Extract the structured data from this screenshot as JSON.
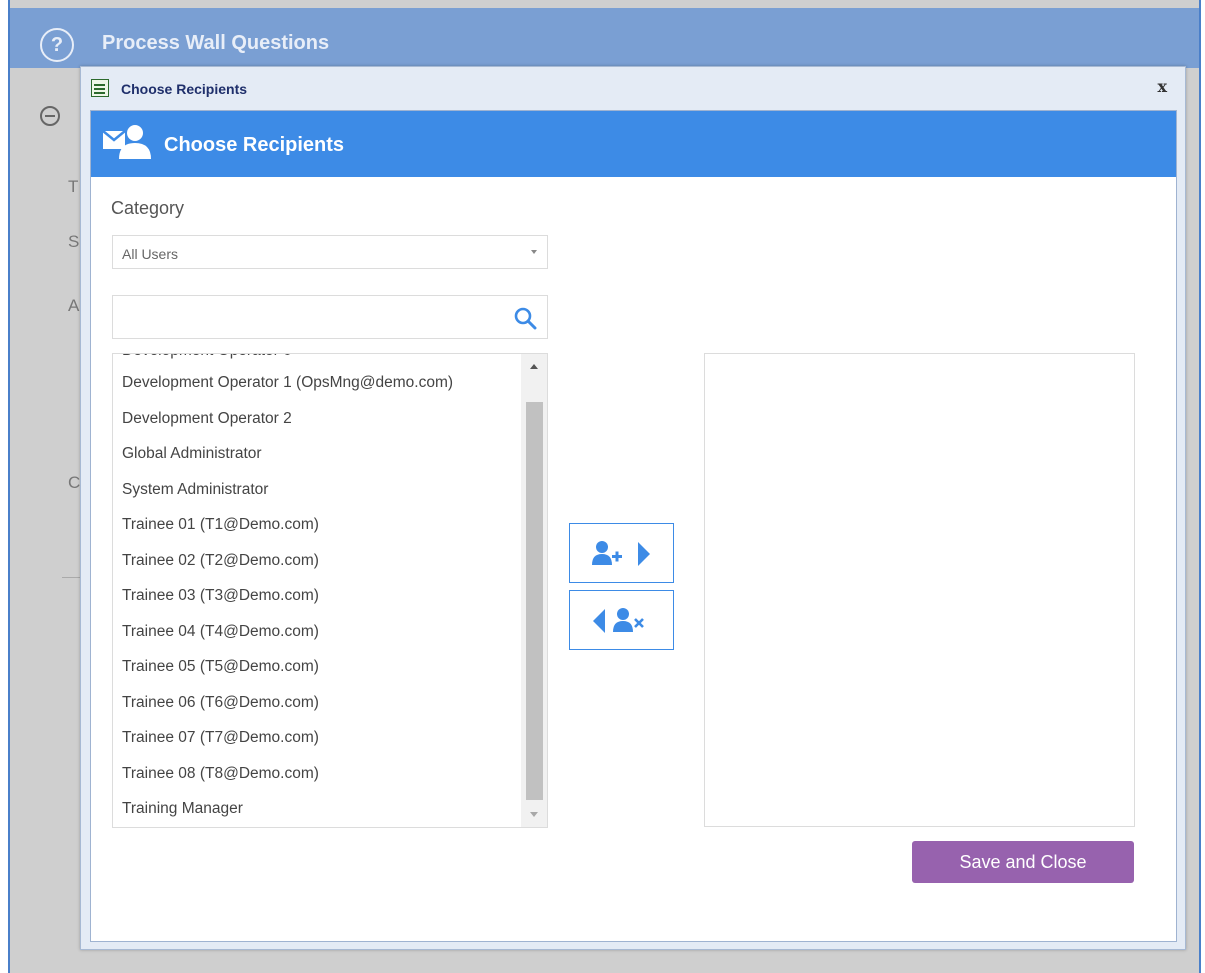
{
  "background": {
    "header_title": "Process Wall Questions",
    "header_icon": "question-circle-icon",
    "partial_letters": [
      "T",
      "S",
      "A",
      "C"
    ]
  },
  "dialog": {
    "window_title": "Choose Recipients",
    "window_icon": "form-window-icon",
    "close_label": "x",
    "band_title": "Choose Recipients",
    "band_icon": "mail-user-icon",
    "category_label": "Category",
    "category_value": "All Users",
    "search_value": "",
    "search_icon": "search-icon",
    "list_items": [
      "Development Operator 1 (OpsMng@demo.com)",
      "Development Operator 2",
      "Global Administrator",
      "System Administrator",
      "Trainee 01 (T1@Demo.com)",
      "Trainee 02 (T2@Demo.com)",
      "Trainee 03 (T3@Demo.com)",
      "Trainee 04 (T4@Demo.com)",
      "Trainee 05 (T5@Demo.com)",
      "Trainee 06 (T6@Demo.com)",
      "Trainee 07 (T7@Demo.com)",
      "Trainee 08 (T8@Demo.com)",
      "Training Manager"
    ],
    "add_button_icon": "add-user-right-icon",
    "remove_button_icon": "remove-user-left-icon",
    "save_label": "Save and Close"
  },
  "colors": {
    "header_blue": "#7a9fd3",
    "band_blue": "#3d8be6",
    "save_purple": "#9762ae"
  }
}
